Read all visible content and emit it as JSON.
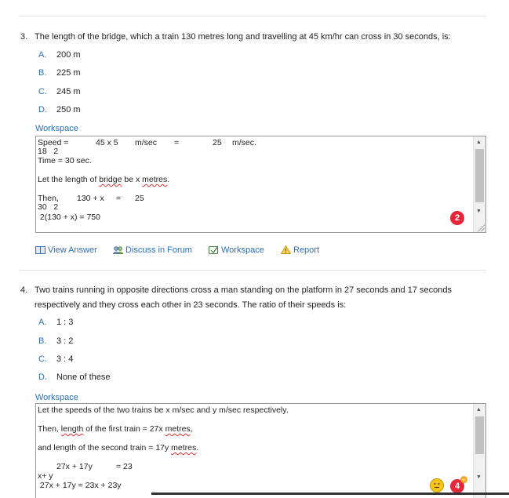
{
  "q3": {
    "number": "3.",
    "text": "The length of the bridge, which a train 130 metres long and travelling at 45 km/hr can cross in 30 seconds, is:",
    "options": [
      {
        "letter": "A.",
        "text": "200 m"
      },
      {
        "letter": "B.",
        "text": "225 m"
      },
      {
        "letter": "C.",
        "text": "245 m"
      },
      {
        "letter": "D.",
        "text": "250 m"
      }
    ],
    "workspace_label": "Workspace",
    "workspace": {
      "speed": "Speed =",
      "frac_num": "45 x 5",
      "unit1": "m/sec",
      "eq": "=",
      "result": "25",
      "unit2": "m/sec.",
      "denoms": "18   2",
      "time": "Time = 30 sec.",
      "let_a": "Let the length of ",
      "let_b": "bridge",
      "let_c": " be x ",
      "let_d": "metres",
      "let_e": ".",
      "then": "Then,",
      "then_num": "130 + x",
      "then_eq": "=",
      "then_res": "25",
      "then_den": "30   2",
      "final": " 2(130 + x) = 750"
    },
    "badge": "2",
    "actions": {
      "view_answer": "View Answer",
      "discuss": "Discuss in Forum",
      "workspace": "Workspace",
      "report": "Report"
    }
  },
  "q4": {
    "number": "4.",
    "text_line1": "Two trains running in opposite directions cross a man standing on the platform in 27 seconds and 17 seconds",
    "text_line2": "respectively and they cross each other in 23 seconds. The ratio of their speeds is:",
    "options": [
      {
        "letter": "A.",
        "text": "1 : 3"
      },
      {
        "letter": "B.",
        "text": "3 : 2"
      },
      {
        "letter": "C.",
        "text": "3 : 4"
      },
      {
        "letter": "D.",
        "text": "None of these"
      }
    ],
    "workspace_label": "Workspace",
    "workspace": {
      "l1": "Let the speeds of the two trains be x m/sec and y m/sec respectively.",
      "l2a": "Then, ",
      "l2b": "length",
      "l2c": " of the first train = 27x ",
      "l2d": "metres",
      "l2e": ",",
      "l3a": "and length of the second train = 17y ",
      "l3b": "metres",
      "l3c": ".",
      "l4a": "27x + 17y",
      "l4b": "= 23",
      "l5": "x+ y",
      "l6": " 27x + 17y = 23x + 23y"
    },
    "badge": "4"
  }
}
